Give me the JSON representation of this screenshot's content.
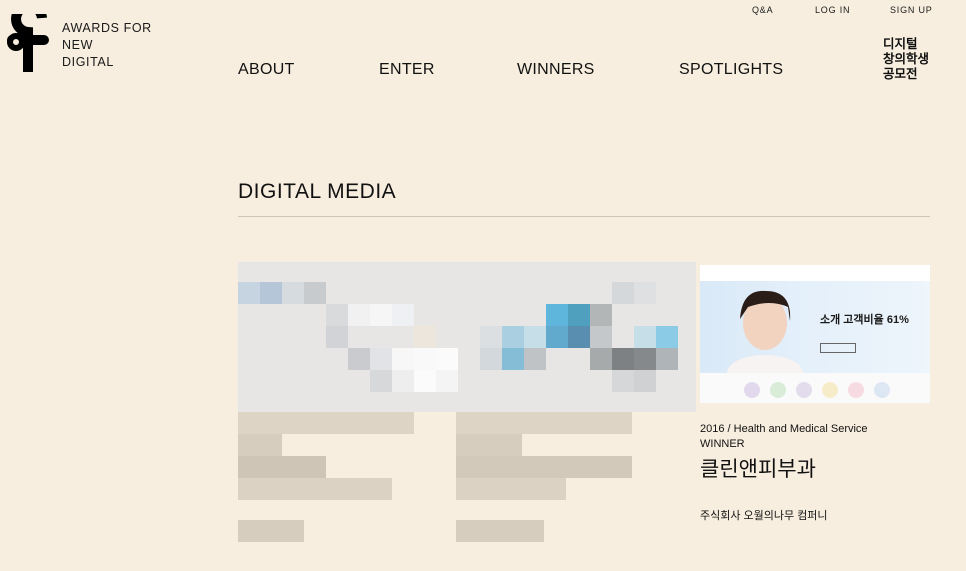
{
  "brand": {
    "lines": [
      "AWARDS FOR",
      "NEW",
      "DIGITAL"
    ],
    "logo_icon": "afnd-logo-icon",
    "logo_color": "#000000"
  },
  "utility_nav": [
    {
      "label": "Q&A"
    },
    {
      "label": "LOG IN"
    },
    {
      "label": "SIGN UP"
    }
  ],
  "main_nav": [
    {
      "label": "ABOUT"
    },
    {
      "label": "ENTER"
    },
    {
      "label": "WINNERS"
    },
    {
      "label": "SPOTLIGHTS"
    }
  ],
  "korean_nav": {
    "lines": [
      "디지털",
      "창의학생",
      "공모전"
    ]
  },
  "section": {
    "title": "DIGITAL MEDIA"
  },
  "entry": {
    "category": "2016 / Health and Medical Service",
    "status": "WINNER",
    "name": "클린앤피부과",
    "company": "주식회사 오월의나무 컴퍼니",
    "thumbnail_headline": "소개 고객비율 61%"
  },
  "colors": {
    "background": "#f7eedf",
    "rule": "#cfc6b6",
    "text": "#111111"
  }
}
